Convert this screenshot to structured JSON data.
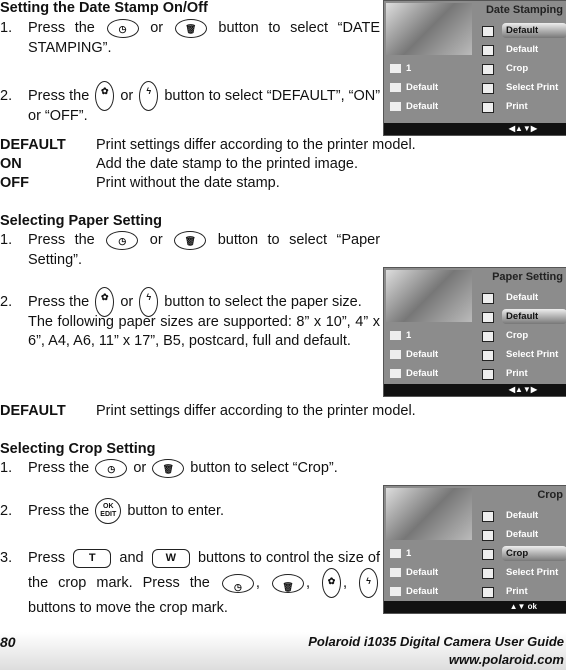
{
  "section1": {
    "heading": "Setting the Date Stamp On/Off",
    "step1": {
      "num": "1.",
      "a": "Press the",
      "or": "or",
      "b": "button to select “DATE STAMPING”."
    },
    "step2": {
      "num": "2.",
      "a": "Press the",
      "or": "or",
      "b": "button to select “DEFAULT”, “ON” or “OFF”."
    },
    "defs": [
      {
        "term": "DEFAULT",
        "desc": "Print settings differ according to the printer model."
      },
      {
        "term": "ON",
        "desc": "Add the date stamp to the printed image."
      },
      {
        "term": "OFF",
        "desc": "Print without the date stamp."
      }
    ]
  },
  "section2": {
    "heading": "Selecting Paper Setting",
    "step1": {
      "num": "1.",
      "a": "Press the",
      "or": "or",
      "b": "button to select “Paper Setting”."
    },
    "step2": {
      "num": "2.",
      "a": "Press the",
      "or": "or",
      "b": "button to select the paper size.",
      "c": "The following paper sizes are supported: 8” x 10”, 4” x 6”, A4, A6, 11” x 17”, B5, postcard, full and default."
    },
    "defs": [
      {
        "term": "DEFAULT",
        "desc": "Print settings differ according to the printer model."
      }
    ]
  },
  "section3": {
    "heading": "Selecting Crop Setting",
    "step1": {
      "num": "1.",
      "a": "Press the",
      "or": "or",
      "b": "button to select “Crop”."
    },
    "step2": {
      "num": "2.",
      "a": "Press the",
      "b": "button to enter."
    },
    "step3": {
      "num": "3.",
      "a": "Press",
      "and": "and",
      "b": "buttons to control the size of the crop mark. Press the",
      "c": "buttons to move the crop mark.",
      "comma": ","
    }
  },
  "buttons": {
    "ok": "OK",
    "edit": "EDIT",
    "t": "T",
    "w": "W"
  },
  "screens": [
    {
      "title": "Date Stamping",
      "rows": [
        "Default",
        "Default",
        "Crop",
        "Select Print",
        "Print"
      ],
      "selected": 0,
      "left": [
        "1",
        "Default",
        "Default"
      ],
      "nav": "◀▲▼▶"
    },
    {
      "title": "Paper Setting",
      "rows": [
        "Default",
        "Default",
        "Crop",
        "Select Print",
        "Print"
      ],
      "selected": 1,
      "left": [
        "1",
        "Default",
        "Default"
      ],
      "nav": "◀▲▼▶"
    },
    {
      "title": "Crop",
      "rows": [
        "Default",
        "Default",
        "Crop",
        "Select Print",
        "Print"
      ],
      "selected": 2,
      "left": [
        "1",
        "Default",
        "Default"
      ],
      "nav": "▲▼  ok"
    }
  ],
  "footer": {
    "page": "80",
    "title": "Polaroid i1035 Digital Camera User Guide",
    "url": "www.polaroid.com"
  }
}
